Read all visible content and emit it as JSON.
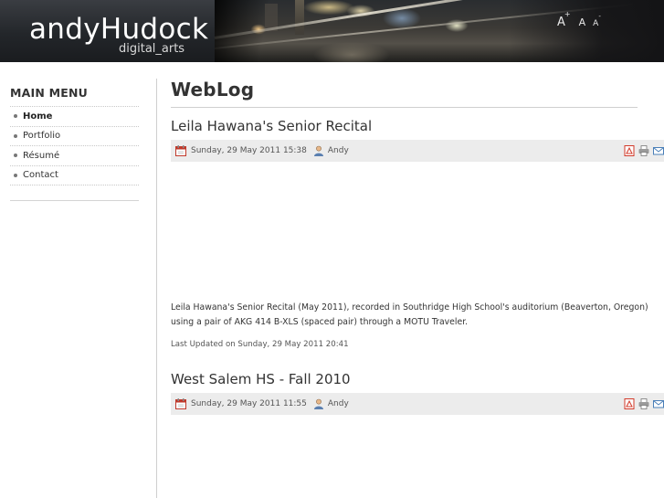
{
  "header": {
    "site_name": "andyHudock",
    "site_tagline": "digital_arts",
    "font_tools": {
      "increase": "A",
      "reset": "A",
      "decrease": "A",
      "plus": "+",
      "minus": "-"
    }
  },
  "sidebar": {
    "title": "MAIN MENU",
    "items": [
      {
        "label": "Home",
        "active": true
      },
      {
        "label": "Portfolio",
        "active": false
      },
      {
        "label": "Résumé",
        "active": false
      },
      {
        "label": "Contact",
        "active": false
      }
    ]
  },
  "main": {
    "page_title": "WebLog",
    "articles": [
      {
        "title": "Leila Hawana's Senior Recital",
        "date": "Sunday, 29 May 2011 15:38",
        "author": "Andy",
        "body": "Leila Hawana's Senior Recital (May 2011), recorded in Southridge High School's auditorium (Beaverton, Oregon) using a pair of AKG 414 B-XLS (spaced pair) through a MOTU Traveler.",
        "updated": "Last Updated on Sunday, 29 May 2011 20:41"
      },
      {
        "title": "West Salem HS - Fall 2010",
        "date": "Sunday, 29 May 2011 11:55",
        "author": "Andy"
      }
    ]
  },
  "colors": {
    "header_bg": "#23262a",
    "meta_bar_bg": "#ececec",
    "pdf_icon": "#d23a2a",
    "calendar_icon": "#c0392b",
    "user_icon": "#5a7fb0"
  }
}
